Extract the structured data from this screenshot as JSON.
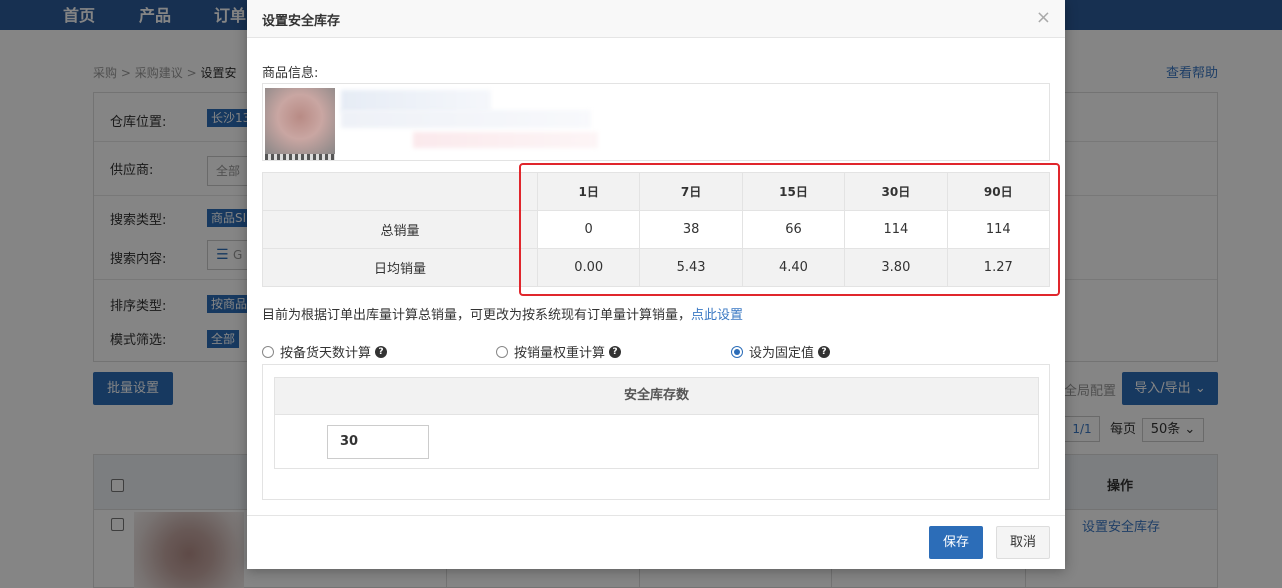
{
  "topnav": {
    "items": [
      "首页",
      "产品",
      "订单"
    ]
  },
  "breadcrumb": {
    "items": [
      "采购",
      "采购建议"
    ],
    "current": "设置安",
    "sep": ">"
  },
  "help": {
    "label": "查看帮助"
  },
  "filters": {
    "warehouse": {
      "label": "仓库位置:",
      "value": "长沙13"
    },
    "supplier": {
      "label": "供应商:",
      "value": "全部"
    },
    "search_type": {
      "label": "搜索类型:",
      "value": "商品SI"
    },
    "search_content": {
      "label": "搜索内容:",
      "value": "G"
    },
    "sort_type": {
      "label": "排序类型:",
      "value": "按商品"
    },
    "mode": {
      "label": "模式筛选:",
      "value": "全部"
    }
  },
  "batch_button": {
    "label": "批量设置"
  },
  "global_config": {
    "label": "全局配置"
  },
  "import_export": {
    "label": "导入/导出"
  },
  "pagination": {
    "page": "1/1",
    "per_page_label": "每页",
    "per_page_value": "50条"
  },
  "table": {
    "op_header": "操作",
    "row_link": "设置安全库存"
  },
  "modal": {
    "title": "设置安全库存",
    "close": "×",
    "product_label": "商品信息:",
    "stats": {
      "headers": [
        "1日",
        "7日",
        "15日",
        "30日",
        "90日"
      ],
      "rows": [
        {
          "label": "总销量",
          "values": [
            "0",
            "38",
            "66",
            "114",
            "114"
          ]
        },
        {
          "label": "日均销量",
          "values": [
            "0.00",
            "5.43",
            "4.40",
            "3.80",
            "1.27"
          ]
        }
      ]
    },
    "note": "目前为根据订单出库量计算总销量，可更改为按系统现有订单量计算销量，",
    "note_link": "点此设置",
    "options": [
      {
        "label": "按备货天数计算",
        "selected": false
      },
      {
        "label": "按销量权重计算",
        "selected": false
      },
      {
        "label": "设为固定值",
        "selected": true
      }
    ],
    "safe_stock_header": "安全库存数",
    "safe_stock_value": "30",
    "save": "保存",
    "cancel": "取消"
  },
  "colors": {
    "primary": "#2c6db8",
    "nav": "#2c5c9b",
    "highlight": "#e0262c",
    "link": "#3a78c3"
  },
  "icons": {
    "question": "question-circle-icon",
    "close": "close-icon",
    "chevron": "chevron-down-icon",
    "list": "list-icon"
  }
}
